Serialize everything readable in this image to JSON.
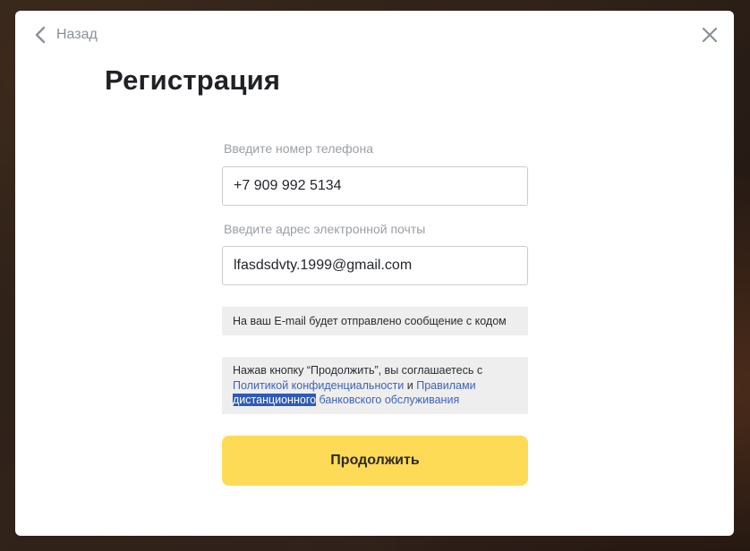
{
  "header": {
    "back_label": "Назад"
  },
  "page_title": "Регистрация",
  "form": {
    "phone_label": "Введите номер телефона",
    "phone_value": "+7 909 992 5134",
    "email_label": "Введите адрес электронной почты",
    "email_value": "lfasdsdvty.1999@gmail.com"
  },
  "notes": {
    "email_notice": "На ваш E-mail будет отправлено сообщение с кодом",
    "consent_prefix": "Нажав кнопку “Продолжить”, вы соглашаетесь с",
    "privacy_link": "Политикой конфиденциальности",
    "conjunction": "и",
    "rules_link_part1": "Правилами",
    "rules_link_selected": "дистанционного",
    "rules_link_part2": "банковского обслуживания"
  },
  "actions": {
    "continue_label": "Продолжить"
  },
  "icons": {
    "back": "chevron-left-icon",
    "close": "close-icon"
  },
  "colors": {
    "accent_button": "#fddb56",
    "link": "#3e63b6",
    "selection": "#2f5bb5",
    "muted_text": "#9a9ea5"
  }
}
